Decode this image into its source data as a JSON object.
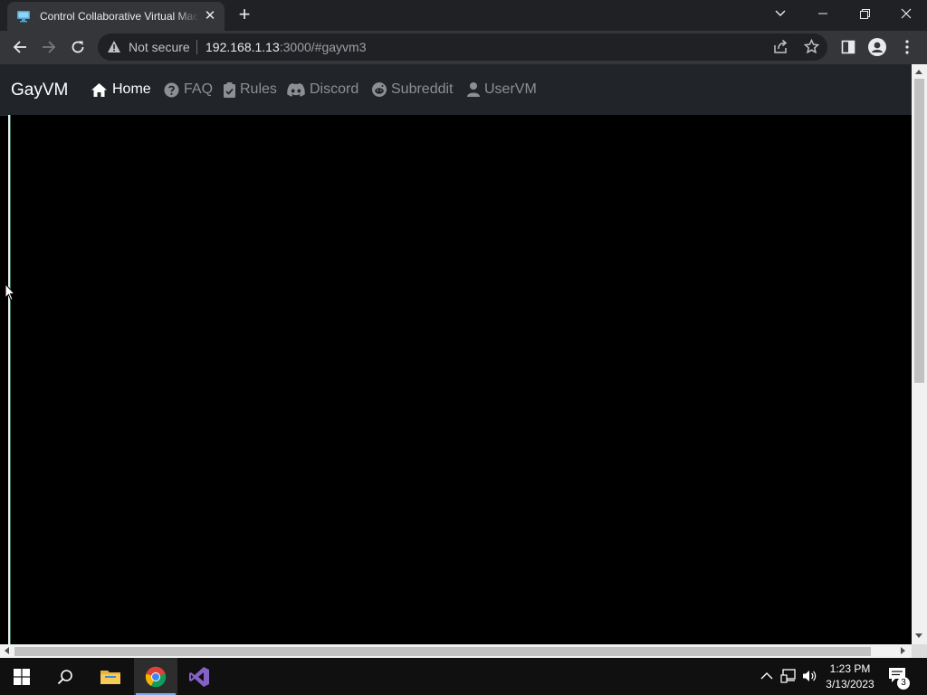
{
  "browser": {
    "tab": {
      "title": "Control Collaborative Virtual Machines",
      "close": "✕"
    },
    "new_tab": "+",
    "address": {
      "security_label": "Not secure",
      "host": "192.168.1.13",
      "rest": ":3000/#gayvm3"
    }
  },
  "site": {
    "brand": "GayVM",
    "nav": [
      {
        "label": "Home",
        "icon": "home-icon",
        "active": true
      },
      {
        "label": "FAQ",
        "icon": "question-circle-icon"
      },
      {
        "label": "Rules",
        "icon": "clipboard-check-icon"
      },
      {
        "label": "Discord",
        "icon": "discord-icon"
      },
      {
        "label": "Subreddit",
        "icon": "reddit-icon"
      },
      {
        "label": "UserVM",
        "icon": "user-icon"
      }
    ]
  },
  "taskbar": {
    "time": "1:23 PM",
    "date": "3/13/2023",
    "notification_count": "3"
  },
  "colors": {
    "tabstrip": "#202124",
    "toolbar": "#35363a",
    "navbar": "#212529",
    "taskbar": "#101010"
  }
}
